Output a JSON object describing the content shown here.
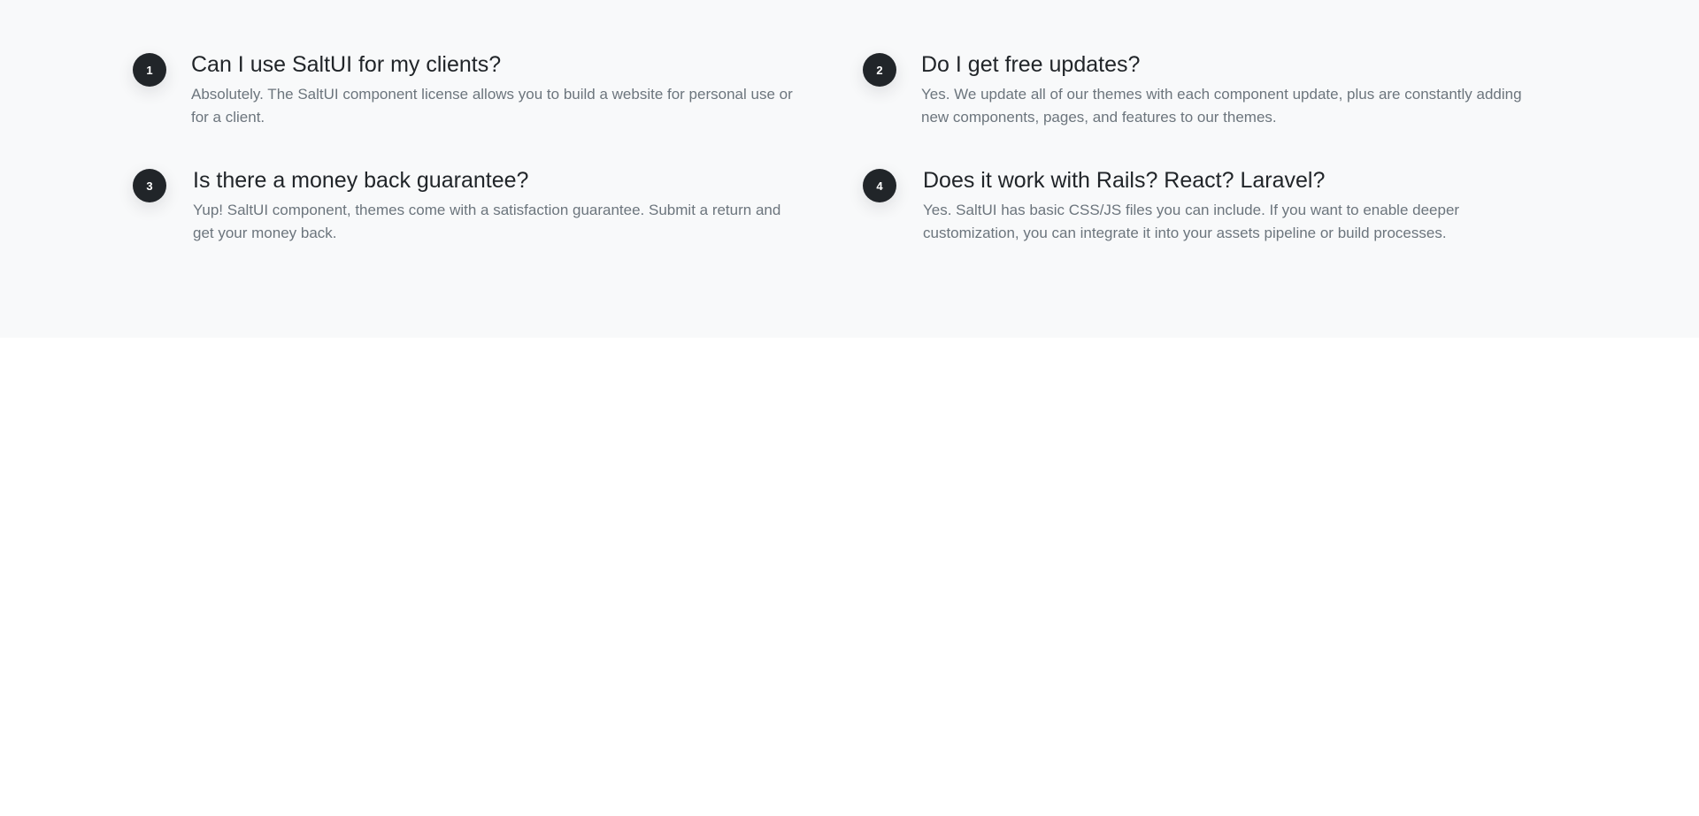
{
  "faq": {
    "items": [
      {
        "number": "1",
        "question": "Can I use SaltUI for my clients?",
        "answer": "Absolutely. The SaltUI component license allows you to build a website for personal use or for a client."
      },
      {
        "number": "2",
        "question": "Do I get free updates?",
        "answer": "Yes. We update all of our themes with each component update, plus are constantly adding new components, pages, and features to our themes."
      },
      {
        "number": "3",
        "question": "Is there a money back guarantee?",
        "answer": "Yup! SaltUI component, themes come with a satisfaction guarantee. Submit a return and get your money back."
      },
      {
        "number": "4",
        "question": "Does it work with Rails? React? Laravel?",
        "answer": "Yes. SaltUI has basic CSS/JS files you can include. If you want to enable deeper customization, you can integrate it into your assets pipeline or build processes."
      }
    ]
  },
  "colors": {
    "section_background": "#f8f9fa",
    "badge_background": "#212529",
    "question_text": "#212529",
    "answer_text": "#6c757d"
  }
}
